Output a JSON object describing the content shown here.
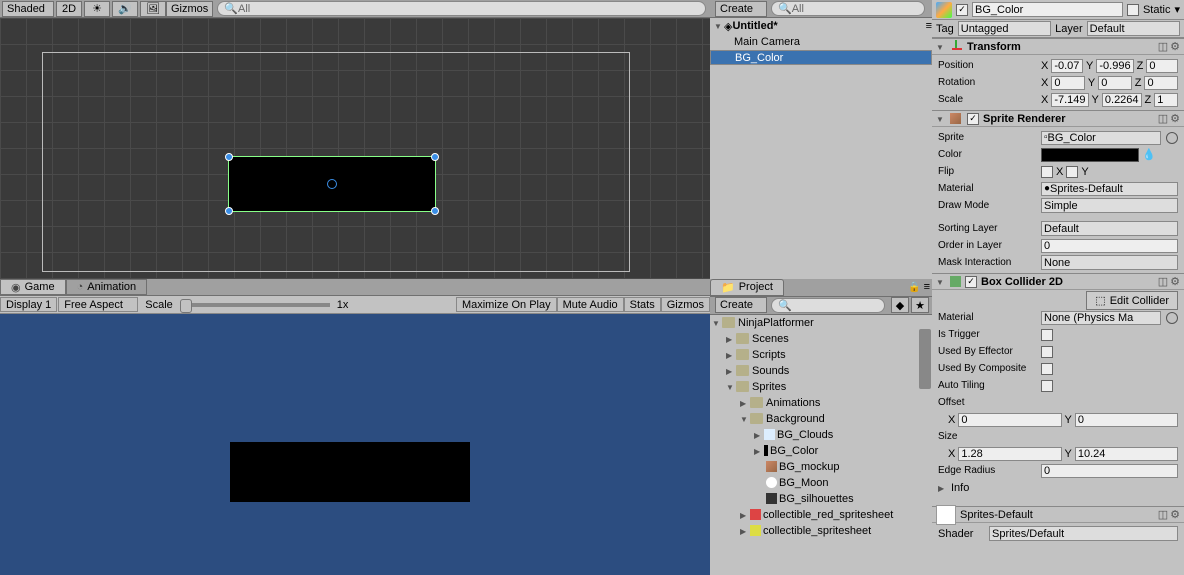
{
  "scene_toolbar": {
    "shading": "Shaded",
    "mode2d": "2D",
    "gizmos": "Gizmos",
    "search_placeholder": "All"
  },
  "hierarchy": {
    "create": "Create",
    "search_placeholder": "All",
    "root": "Untitled*",
    "items": [
      "Main Camera",
      "BG_Color"
    ]
  },
  "game_tabs": {
    "game": "Game",
    "animation": "Animation"
  },
  "game_toolbar": {
    "display": "Display 1",
    "aspect": "Free Aspect",
    "scale_label": "Scale",
    "scale_val": "1x",
    "max": "Maximize On Play",
    "mute": "Mute Audio",
    "stats": "Stats",
    "gizmos": "Gizmos"
  },
  "project": {
    "tab": "Project",
    "create": "Create",
    "root": "NinjaPlatformer",
    "folders": [
      "Scenes",
      "Scripts",
      "Sounds",
      "Sprites"
    ],
    "sprites_sub": "Animations",
    "bg_folder": "Background",
    "bg_items": [
      "BG_Clouds",
      "BG_Color",
      "BG_mockup",
      "BG_Moon",
      "BG_silhouettes"
    ],
    "extra": [
      "collectible_red_spritesheet",
      "collectible_spritesheet"
    ]
  },
  "inspector": {
    "name": "BG_Color",
    "static": "Static",
    "tag_label": "Tag",
    "tag": "Untagged",
    "layer_label": "Layer",
    "layer": "Default",
    "transform": {
      "title": "Transform",
      "pos": "Position",
      "rot": "Rotation",
      "scale": "Scale",
      "px": "-0.07",
      "py": "-0.996",
      "pz": "0",
      "rx": "0",
      "ry": "0",
      "rz": "0",
      "sx": "-7.149",
      "sy": "0.2264",
      "sz": "1"
    },
    "sprite": {
      "title": "Sprite Renderer",
      "sprite_l": "Sprite",
      "sprite_v": "BG_Color",
      "color_l": "Color",
      "flip_l": "Flip",
      "flipx": "X",
      "flipy": "Y",
      "mat_l": "Material",
      "mat_v": "Sprites-Default",
      "draw_l": "Draw Mode",
      "draw_v": "Simple",
      "sort_l": "Sorting Layer",
      "sort_v": "Default",
      "order_l": "Order in Layer",
      "order_v": "0",
      "mask_l": "Mask Interaction",
      "mask_v": "None"
    },
    "box": {
      "title": "Box Collider 2D",
      "edit": "Edit Collider",
      "mat_l": "Material",
      "mat_v": "None (Physics Ma",
      "trig_l": "Is Trigger",
      "eff_l": "Used By Effector",
      "comp_l": "Used By Composite",
      "auto_l": "Auto Tiling",
      "off_l": "Offset",
      "ox": "0",
      "oy": "0",
      "size_l": "Size",
      "sx": "1.28",
      "sy": "10.24",
      "edge_l": "Edge Radius",
      "edge_v": "0",
      "info": "Info"
    },
    "mat_footer": {
      "name": "Sprites-Default",
      "shader_l": "Shader",
      "shader_v": "Sprites/Default"
    }
  }
}
